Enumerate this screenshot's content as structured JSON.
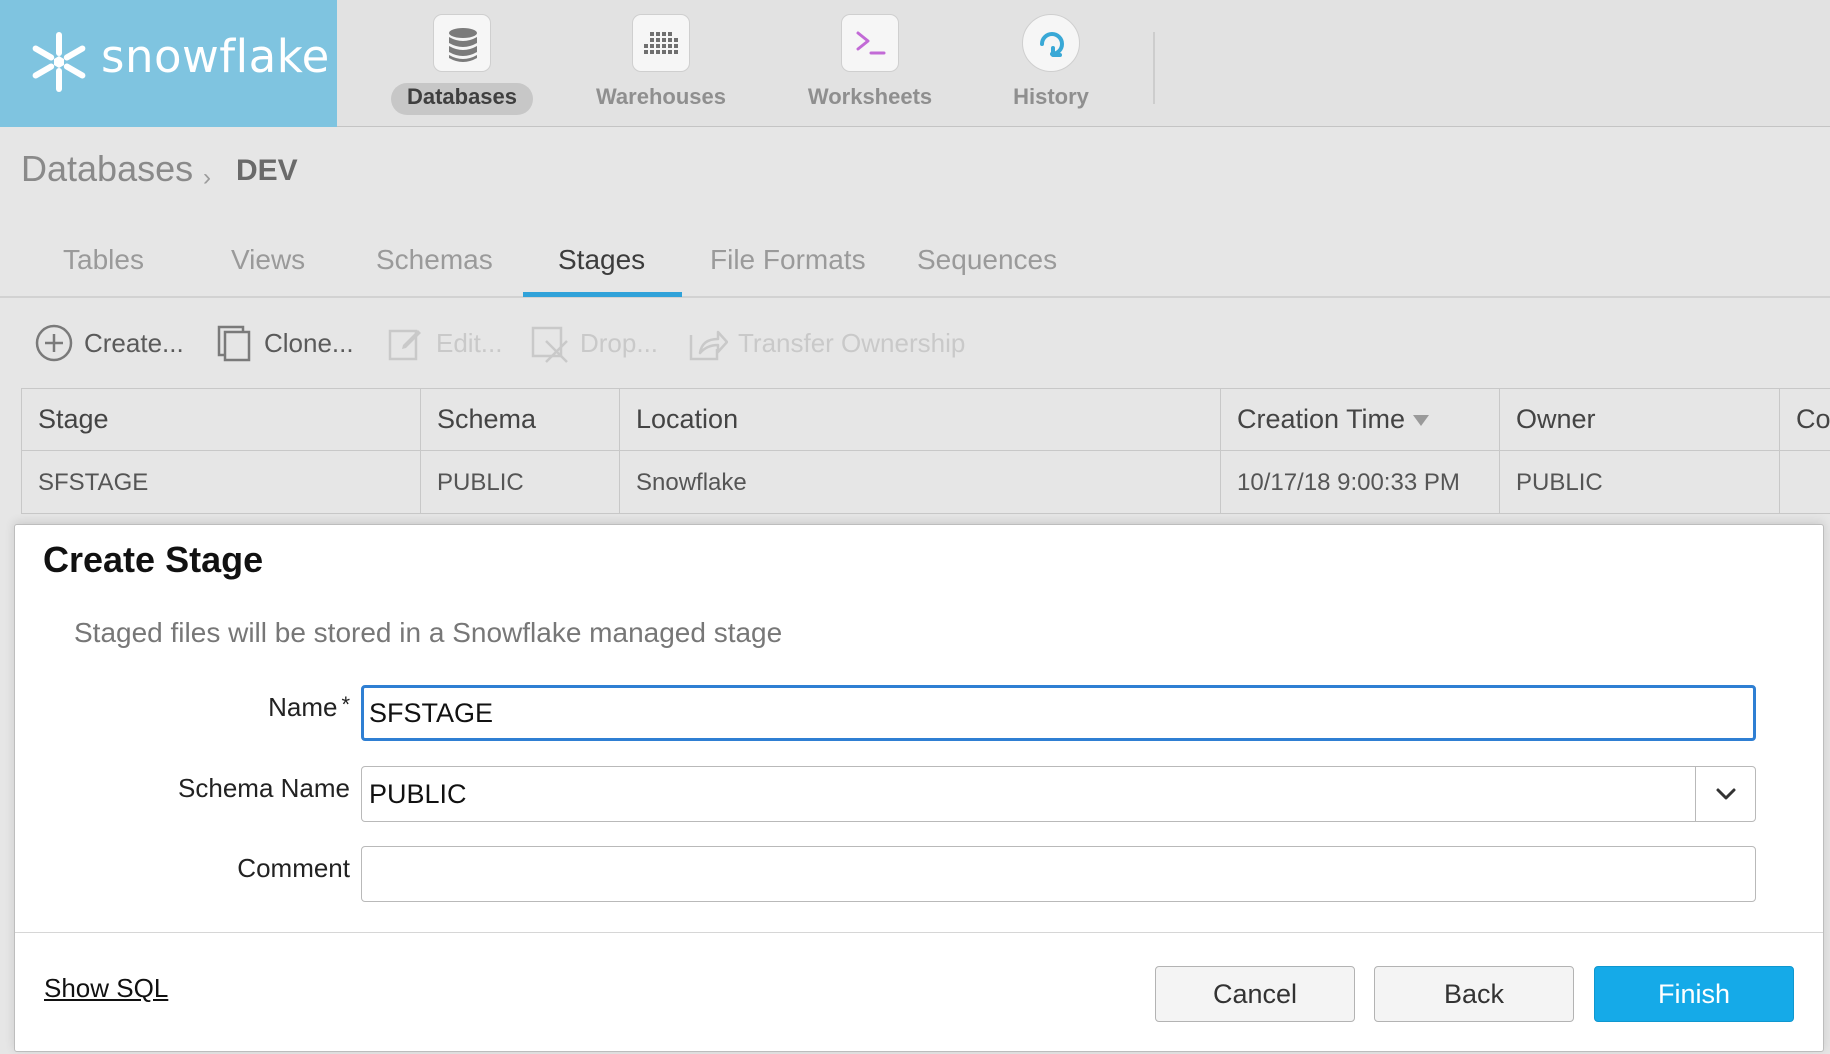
{
  "brand": {
    "name": "snowflake"
  },
  "nav": {
    "items": [
      {
        "label": "Databases",
        "icon": "database-icon",
        "active": true
      },
      {
        "label": "Warehouses",
        "icon": "warehouse-grid-icon",
        "active": false
      },
      {
        "label": "Worksheets",
        "icon": "terminal-prompt-icon",
        "active": false
      },
      {
        "label": "History",
        "icon": "history-refresh-icon",
        "active": false
      }
    ]
  },
  "breadcrumb": {
    "root": "Databases",
    "separator": "›",
    "current": "DEV"
  },
  "tabs": [
    {
      "label": "Tables",
      "active": false
    },
    {
      "label": "Views",
      "active": false
    },
    {
      "label": "Schemas",
      "active": false
    },
    {
      "label": "Stages",
      "active": true
    },
    {
      "label": "File Formats",
      "active": false
    },
    {
      "label": "Sequences",
      "active": false
    }
  ],
  "toolbar": {
    "create": "Create...",
    "clone": "Clone...",
    "edit": "Edit...",
    "drop": "Drop...",
    "transfer": "Transfer Ownership"
  },
  "table": {
    "columns": [
      "Stage",
      "Schema",
      "Location",
      "Creation Time",
      "Owner",
      "Co"
    ],
    "sorted_column": "Creation Time",
    "rows": [
      {
        "stage": "SFSTAGE",
        "schema": "PUBLIC",
        "location": "Snowflake",
        "creation_time": "10/17/18 9:00:33 PM",
        "owner": "PUBLIC",
        "comment": ""
      }
    ]
  },
  "dialog": {
    "title": "Create Stage",
    "description": "Staged files will be stored in a Snowflake managed stage",
    "fields": {
      "name_label": "Name",
      "required_marker": "*",
      "name_value": "SFSTAGE",
      "schema_label": "Schema Name",
      "schema_value": "PUBLIC",
      "comment_label": "Comment",
      "comment_value": ""
    },
    "show_sql": "Show SQL",
    "buttons": {
      "cancel": "Cancel",
      "back": "Back",
      "finish": "Finish"
    }
  },
  "colors": {
    "brand_bg": "#7fc4e0",
    "tab_accent": "#30a2d9",
    "focus_border": "#2f7fd3",
    "primary_button": "#15aae8"
  }
}
